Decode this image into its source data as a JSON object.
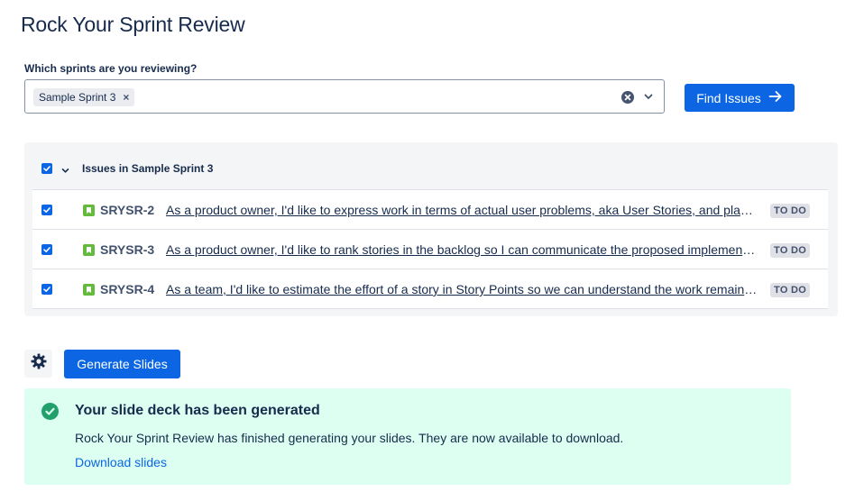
{
  "page": {
    "title": "Rock Your Sprint Review"
  },
  "sprint_picker": {
    "label": "Which sprints are you reviewing?",
    "selected_chip": "Sample Sprint 3",
    "chip_remove_glyph": "×",
    "clear_icon": "clear-circle-icon",
    "dropdown_icon": "chevron-down-icon"
  },
  "find_button": {
    "label": "Find Issues",
    "icon": "arrow-right-icon"
  },
  "issues_panel": {
    "header_label": "Issues in Sample Sprint 3",
    "issues": [
      {
        "key": "SRYSR-2",
        "summary": "As a product owner, I'd like to express work in terms of actual user problems, aka User Stories, and place them in the backlog",
        "status": "TO DO",
        "checked": true
      },
      {
        "key": "SRYSR-3",
        "summary": "As a product owner, I'd like to rank stories in the backlog so I can communicate the proposed implementation order",
        "status": "TO DO",
        "checked": true
      },
      {
        "key": "SRYSR-4",
        "summary": "As a team, I'd like to estimate the effort of a story in Story Points so we can understand the work remaining",
        "status": "TO DO",
        "checked": true
      }
    ]
  },
  "actions": {
    "settings_icon": "gear-icon",
    "generate_label": "Generate Slides"
  },
  "success_banner": {
    "title": "Your slide deck has been generated",
    "message": "Rock Your Sprint Review has finished generating your slides. They are now available to download.",
    "link_label": "Download slides"
  },
  "colors": {
    "primary": "#0c66e4",
    "success_bg": "#dcfff1",
    "success_icon": "#22a06b",
    "story_icon": "#63ba3c",
    "panel_bg": "#f4f5f7"
  }
}
